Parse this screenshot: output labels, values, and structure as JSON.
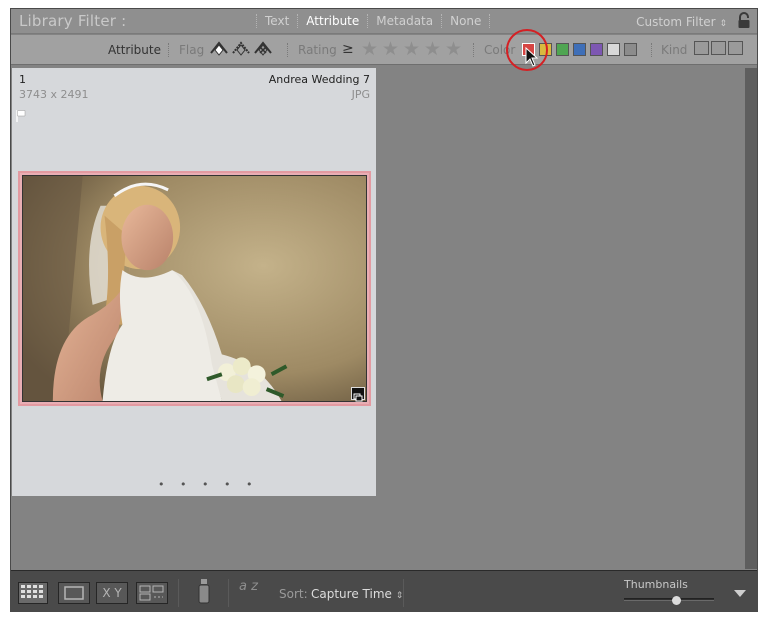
{
  "filter_bar": {
    "title": "Library Filter :",
    "tabs": [
      {
        "label": "Text",
        "active": false
      },
      {
        "label": "Attribute",
        "active": true
      },
      {
        "label": "Metadata",
        "active": false
      },
      {
        "label": "None",
        "active": false
      }
    ],
    "preset": "Custom Filter",
    "preset_arrow": "⇕",
    "lock_icon": "lock-icon"
  },
  "attribute_bar": {
    "label": "Attribute",
    "flag_label": "Flag",
    "rating_label": "Rating",
    "rating_operator": "≥",
    "rating_stars": 5,
    "color_label": "Color",
    "colors": [
      "#d64543",
      "#d9b93f",
      "#4fa552",
      "#3f6fb8",
      "#7d57b2",
      "#d8d8d8",
      "#8c8c8c"
    ],
    "selected_color": "red",
    "kind_label": "Kind"
  },
  "grid": {
    "cell": {
      "index": "1",
      "dimensions": "3743 x 2491",
      "filename": "Andrea Wedding 7",
      "filetype": "JPG",
      "color_label": "#e39aa1"
    },
    "dots": "• • • • •"
  },
  "toolbar": {
    "sort_label": "Sort:",
    "sort_value": "Capture Time",
    "sort_arrow": "⇕",
    "thumbnails_label": "Thumbnails",
    "thumbnail_size": 0.6,
    "xy_label": "X Y",
    "az_label": "a z"
  }
}
